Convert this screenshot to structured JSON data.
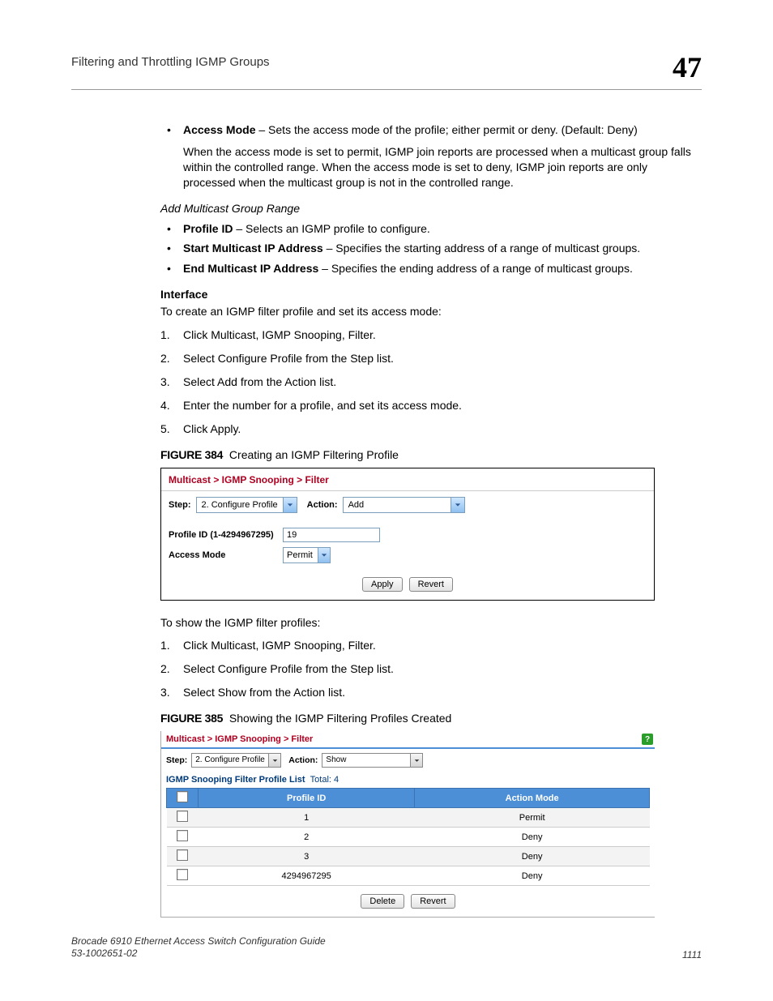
{
  "header": {
    "title": "Filtering and Throttling IGMP Groups",
    "chapter": "47"
  },
  "bullets1": {
    "access_mode_label": "Access Mode",
    "access_mode_desc": " – Sets the access mode of the profile; either permit or deny. (Default: Deny)",
    "access_mode_long": "When the access mode is set to permit, IGMP join reports are processed when a multicast group falls within the controlled range. When the access mode is set to deny, IGMP join reports are only processed when the multicast group is not in the controlled range."
  },
  "italic_head": "Add Multicast Group Range",
  "bullets2": [
    {
      "label": "Profile ID",
      "desc": " – Selects an IGMP profile to configure."
    },
    {
      "label": "Start Multicast IP Address",
      "desc": " – Specifies the starting address of a range of multicast groups."
    },
    {
      "label": "End Multicast IP Address",
      "desc": " – Specifies the ending address of a range of multicast groups."
    }
  ],
  "interface_head": "Interface",
  "interface_lead": "To create an IGMP filter profile and set its access mode:",
  "steps1": [
    "Click Multicast, IGMP Snooping, Filter.",
    "Select Configure Profile from the Step list.",
    "Select Add from the Action list.",
    "Enter the number for a profile, and set its access mode.",
    "Click Apply."
  ],
  "fig384": {
    "label": "FIGURE 384",
    "caption": "Creating an IGMP Filtering Profile",
    "breadcrumb": "Multicast > IGMP Snooping > Filter",
    "step_label": "Step:",
    "step_value": "2. Configure Profile",
    "action_label": "Action:",
    "action_value": "Add",
    "profile_id_label": "Profile ID (1-4294967295)",
    "profile_id_value": "19",
    "access_mode_label": "Access Mode",
    "access_mode_value": "Permit",
    "apply": "Apply",
    "revert": "Revert"
  },
  "mid_text": "To show the IGMP filter profiles:",
  "steps2": [
    "Click Multicast, IGMP Snooping, Filter.",
    "Select Configure Profile from the Step list.",
    "Select Show from the Action list."
  ],
  "fig385": {
    "label": "FIGURE 385",
    "caption": "Showing the IGMP Filtering Profiles Created",
    "breadcrumb": "Multicast > IGMP Snooping > Filter",
    "step_label": "Step:",
    "step_value": "2. Configure Profile",
    "action_label": "Action:",
    "action_value": "Show",
    "list_head": "IGMP Snooping Filter Profile List",
    "total_label": "Total:",
    "total_value": "4",
    "col_profile": "Profile ID",
    "col_action": "Action Mode",
    "rows": [
      {
        "id": "1",
        "mode": "Permit"
      },
      {
        "id": "2",
        "mode": "Deny"
      },
      {
        "id": "3",
        "mode": "Deny"
      },
      {
        "id": "4294967295",
        "mode": "Deny"
      }
    ],
    "delete": "Delete",
    "revert": "Revert"
  },
  "footer": {
    "line1": "Brocade 6910 Ethernet Access Switch Configuration Guide",
    "line2": "53-1002651-02",
    "page": "1111"
  }
}
